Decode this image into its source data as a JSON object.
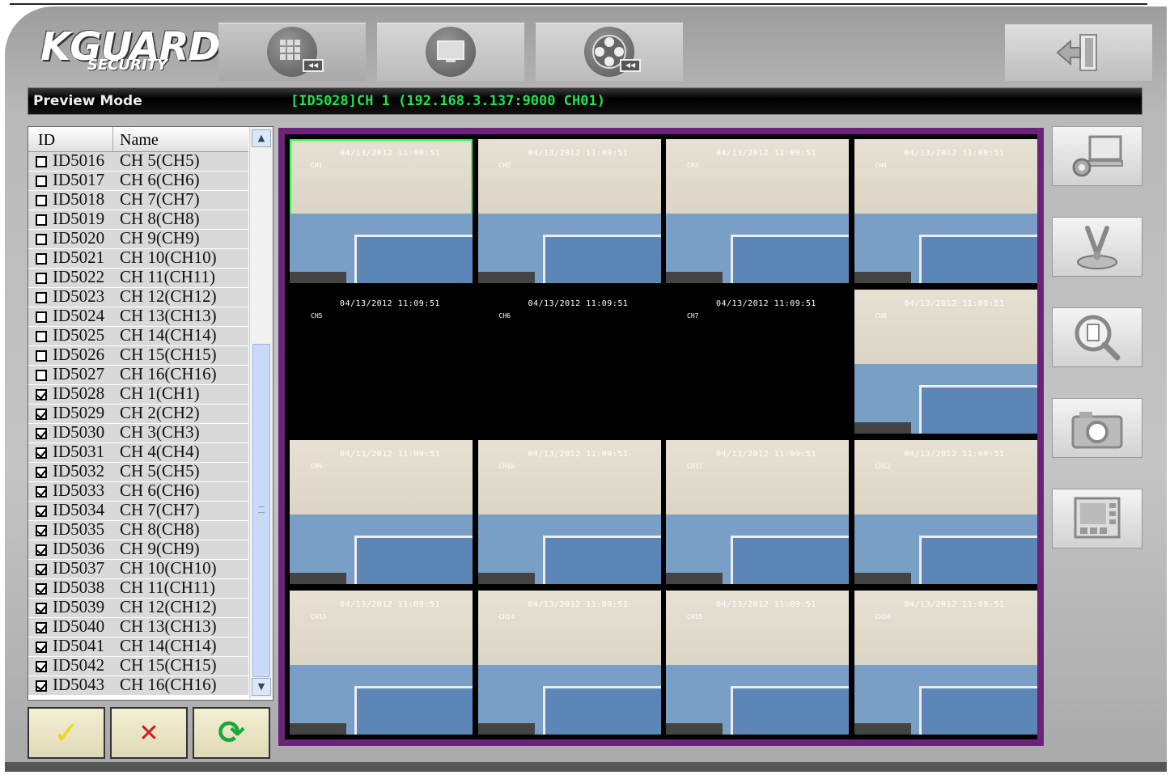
{
  "logo": {
    "main": "KGUARD",
    "sub": "SECURITY"
  },
  "toolbar": {
    "tabs": [
      {
        "name": "preview",
        "icon": "grid-playback-icon",
        "active": true
      },
      {
        "name": "display",
        "icon": "monitor-icon",
        "active": false
      },
      {
        "name": "playback",
        "icon": "film-reel-icon",
        "active": false
      }
    ],
    "exit_icon": "exit-door-icon"
  },
  "status": {
    "mode": "Preview Mode",
    "channel_info": "[ID5028]CH 1 (192.168.3.137:9000 CH01)"
  },
  "device_list": {
    "header_id": "ID",
    "header_name": "Name",
    "rows": [
      {
        "id": "ID5016",
        "name": "CH 5(CH5)",
        "checked": false
      },
      {
        "id": "ID5017",
        "name": "CH 6(CH6)",
        "checked": false
      },
      {
        "id": "ID5018",
        "name": "CH 7(CH7)",
        "checked": false
      },
      {
        "id": "ID5019",
        "name": "CH 8(CH8)",
        "checked": false
      },
      {
        "id": "ID5020",
        "name": "CH 9(CH9)",
        "checked": false
      },
      {
        "id": "ID5021",
        "name": "CH 10(CH10)",
        "checked": false
      },
      {
        "id": "ID5022",
        "name": "CH 11(CH11)",
        "checked": false
      },
      {
        "id": "ID5023",
        "name": "CH 12(CH12)",
        "checked": false
      },
      {
        "id": "ID5024",
        "name": "CH 13(CH13)",
        "checked": false
      },
      {
        "id": "ID5025",
        "name": "CH 14(CH14)",
        "checked": false
      },
      {
        "id": "ID5026",
        "name": "CH 15(CH15)",
        "checked": false
      },
      {
        "id": "ID5027",
        "name": "CH 16(CH16)",
        "checked": false
      },
      {
        "id": "ID5028",
        "name": "CH 1(CH1)",
        "checked": true
      },
      {
        "id": "ID5029",
        "name": "CH 2(CH2)",
        "checked": true
      },
      {
        "id": "ID5030",
        "name": "CH 3(CH3)",
        "checked": true
      },
      {
        "id": "ID5031",
        "name": "CH 4(CH4)",
        "checked": true
      },
      {
        "id": "ID5032",
        "name": "CH 5(CH5)",
        "checked": true
      },
      {
        "id": "ID5033",
        "name": "CH 6(CH6)",
        "checked": true
      },
      {
        "id": "ID5034",
        "name": "CH 7(CH7)",
        "checked": true
      },
      {
        "id": "ID5035",
        "name": "CH 8(CH8)",
        "checked": true
      },
      {
        "id": "ID5036",
        "name": "CH 9(CH9)",
        "checked": true
      },
      {
        "id": "ID5037",
        "name": "CH 10(CH10)",
        "checked": true
      },
      {
        "id": "ID5038",
        "name": "CH 11(CH11)",
        "checked": true
      },
      {
        "id": "ID5039",
        "name": "CH 12(CH12)",
        "checked": true
      },
      {
        "id": "ID5040",
        "name": "CH 13(CH13)",
        "checked": true
      },
      {
        "id": "ID5041",
        "name": "CH 14(CH14)",
        "checked": true
      },
      {
        "id": "ID5042",
        "name": "CH 15(CH15)",
        "checked": true
      },
      {
        "id": "ID5043",
        "name": "CH 16(CH16)",
        "checked": true
      }
    ]
  },
  "actions": {
    "confirm_icon": "checkmark-icon",
    "confirm_glyph": "✓",
    "cancel_icon": "x-icon",
    "cancel_glyph": "✕",
    "refresh_icon": "refresh-icon",
    "refresh_glyph": "⟳"
  },
  "video_grid": {
    "selected_index": 0,
    "cells": [
      {
        "channel": "CH1",
        "timestamp": "04/13/2012 11:09:51",
        "video": true
      },
      {
        "channel": "CH2",
        "timestamp": "04/13/2012 11:09:51",
        "video": true
      },
      {
        "channel": "CH3",
        "timestamp": "04/13/2012 11:09:51",
        "video": true
      },
      {
        "channel": "CH4",
        "timestamp": "04/13/2012 11:09:51",
        "video": true
      },
      {
        "channel": "CH5",
        "timestamp": "04/13/2012 11:09:51",
        "video": false
      },
      {
        "channel": "CH6",
        "timestamp": "04/13/2012 11:09:51",
        "video": false
      },
      {
        "channel": "CH7",
        "timestamp": "04/13/2012 11:09:51",
        "video": false
      },
      {
        "channel": "CH8",
        "timestamp": "04/13/2012 11:09:51",
        "video": true
      },
      {
        "channel": "CH9",
        "timestamp": "04/13/2012 11:09:51",
        "video": true
      },
      {
        "channel": "CH10",
        "timestamp": "04/13/2012 11:09:51",
        "video": true
      },
      {
        "channel": "CH11",
        "timestamp": "04/13/2012 11:09:51",
        "video": true
      },
      {
        "channel": "CH12",
        "timestamp": "04/13/2012 11:09:51",
        "video": true
      },
      {
        "channel": "CH13",
        "timestamp": "04/13/2012 11:09:51",
        "video": true
      },
      {
        "channel": "CH14",
        "timestamp": "04/13/2012 11:09:51",
        "video": true
      },
      {
        "channel": "CH15",
        "timestamp": "04/13/2012 11:09:51",
        "video": true
      },
      {
        "channel": "CH16",
        "timestamp": "04/13/2012 11:09:51",
        "video": true
      }
    ]
  },
  "side_buttons": [
    {
      "name": "remote-settings-button",
      "icon": "computer-gear-icon"
    },
    {
      "name": "ptz-control-button",
      "icon": "joystick-icon"
    },
    {
      "name": "log-search-button",
      "icon": "magnifier-document-icon"
    },
    {
      "name": "snapshot-button",
      "icon": "camera-icon"
    },
    {
      "name": "layout-button",
      "icon": "split-screen-icon"
    }
  ],
  "colors": {
    "status_text": "#1ee64c",
    "grid_border": "#6a2378",
    "selected_cell": "#32ff4f",
    "cancel": "#d01818",
    "confirm": "#f2d51a",
    "refresh": "#1aa83a"
  }
}
